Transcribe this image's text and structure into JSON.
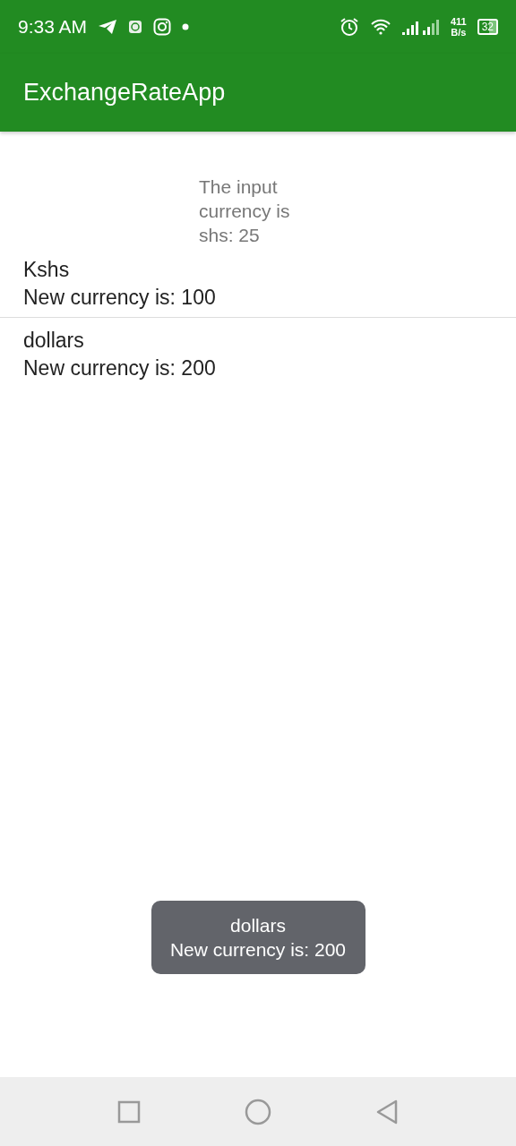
{
  "status_bar": {
    "time": "9:33 AM",
    "net_speed": "411",
    "net_unit": "B/s",
    "battery": "32"
  },
  "app_bar": {
    "title": "ExchangeRateApp"
  },
  "input_label": "The input currency is shs: 25",
  "items": [
    {
      "name": "Kshs",
      "result": "New currency is: 100"
    },
    {
      "name": "dollars",
      "result": "New currency is: 200"
    }
  ],
  "toast": {
    "name": "dollars",
    "result": "New currency is: 200"
  }
}
